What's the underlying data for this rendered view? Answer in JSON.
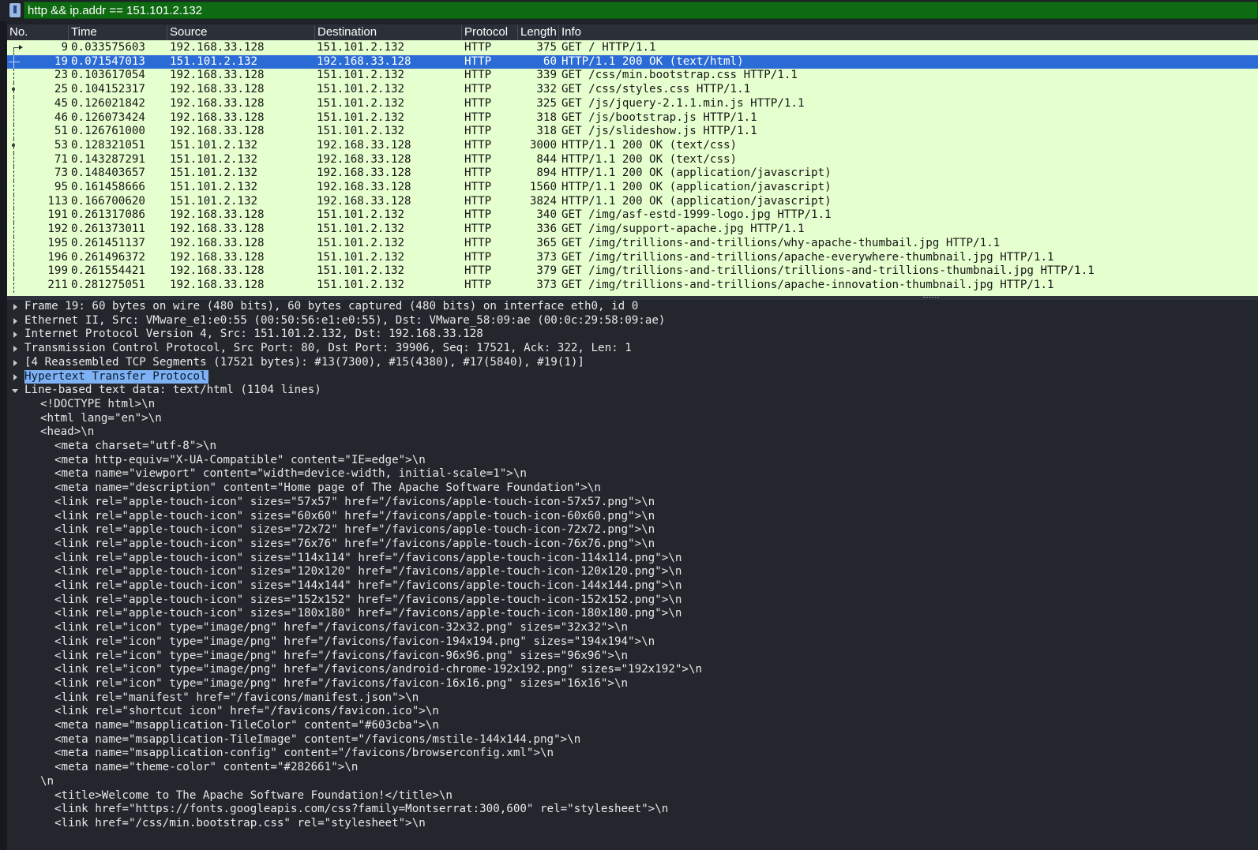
{
  "filter": {
    "value": "http && ip.addr == 151.101.2.132"
  },
  "columns": [
    "No.",
    "Time",
    "Source",
    "Destination",
    "Protocol",
    "Length",
    "Info"
  ],
  "packets": [
    {
      "no": "9",
      "time": "0.033575603",
      "src": "192.168.33.128",
      "dst": "151.101.2.132",
      "proto": "HTTP",
      "len": "375",
      "info": "GET / HTTP/1.1",
      "mark": "arrow"
    },
    {
      "no": "19",
      "time": "0.071547013",
      "src": "151.101.2.132",
      "dst": "192.168.33.128",
      "proto": "HTTP",
      "len": "60",
      "info": "HTTP/1.1 200 OK  (text/html)",
      "mark": "selected"
    },
    {
      "no": "23",
      "time": "0.103617054",
      "src": "192.168.33.128",
      "dst": "151.101.2.132",
      "proto": "HTTP",
      "len": "339",
      "info": "GET /css/min.bootstrap.css HTTP/1.1",
      "mark": "line"
    },
    {
      "no": "25",
      "time": "0.104152317",
      "src": "192.168.33.128",
      "dst": "151.101.2.132",
      "proto": "HTTP",
      "len": "332",
      "info": "GET /css/styles.css HTTP/1.1",
      "mark": "dot"
    },
    {
      "no": "45",
      "time": "0.126021842",
      "src": "192.168.33.128",
      "dst": "151.101.2.132",
      "proto": "HTTP",
      "len": "325",
      "info": "GET /js/jquery-2.1.1.min.js HTTP/1.1",
      "mark": "line"
    },
    {
      "no": "46",
      "time": "0.126073424",
      "src": "192.168.33.128",
      "dst": "151.101.2.132",
      "proto": "HTTP",
      "len": "318",
      "info": "GET /js/bootstrap.js HTTP/1.1",
      "mark": "line"
    },
    {
      "no": "51",
      "time": "0.126761000",
      "src": "192.168.33.128",
      "dst": "151.101.2.132",
      "proto": "HTTP",
      "len": "318",
      "info": "GET /js/slideshow.js HTTP/1.1",
      "mark": "line"
    },
    {
      "no": "53",
      "time": "0.128321051",
      "src": "151.101.2.132",
      "dst": "192.168.33.128",
      "proto": "HTTP",
      "len": "3000",
      "info": "HTTP/1.1 200 OK  (text/css)",
      "mark": "dot"
    },
    {
      "no": "71",
      "time": "0.143287291",
      "src": "151.101.2.132",
      "dst": "192.168.33.128",
      "proto": "HTTP",
      "len": "844",
      "info": "HTTP/1.1 200 OK  (text/css)",
      "mark": "line"
    },
    {
      "no": "73",
      "time": "0.148403657",
      "src": "151.101.2.132",
      "dst": "192.168.33.128",
      "proto": "HTTP",
      "len": "894",
      "info": "HTTP/1.1 200 OK  (application/javascript)",
      "mark": "line"
    },
    {
      "no": "95",
      "time": "0.161458666",
      "src": "151.101.2.132",
      "dst": "192.168.33.128",
      "proto": "HTTP",
      "len": "1560",
      "info": "HTTP/1.1 200 OK  (application/javascript)",
      "mark": "line"
    },
    {
      "no": "113",
      "time": "0.166700620",
      "src": "151.101.2.132",
      "dst": "192.168.33.128",
      "proto": "HTTP",
      "len": "3824",
      "info": "HTTP/1.1 200 OK  (application/javascript)",
      "mark": "line"
    },
    {
      "no": "191",
      "time": "0.261317086",
      "src": "192.168.33.128",
      "dst": "151.101.2.132",
      "proto": "HTTP",
      "len": "340",
      "info": "GET /img/asf-estd-1999-logo.jpg HTTP/1.1",
      "mark": "line"
    },
    {
      "no": "192",
      "time": "0.261373011",
      "src": "192.168.33.128",
      "dst": "151.101.2.132",
      "proto": "HTTP",
      "len": "336",
      "info": "GET /img/support-apache.jpg HTTP/1.1",
      "mark": "line"
    },
    {
      "no": "195",
      "time": "0.261451137",
      "src": "192.168.33.128",
      "dst": "151.101.2.132",
      "proto": "HTTP",
      "len": "365",
      "info": "GET /img/trillions-and-trillions/why-apache-thumbail.jpg HTTP/1.1",
      "mark": "line"
    },
    {
      "no": "196",
      "time": "0.261496372",
      "src": "192.168.33.128",
      "dst": "151.101.2.132",
      "proto": "HTTP",
      "len": "373",
      "info": "GET /img/trillions-and-trillions/apache-everywhere-thumbnail.jpg HTTP/1.1",
      "mark": "line"
    },
    {
      "no": "199",
      "time": "0.261554421",
      "src": "192.168.33.128",
      "dst": "151.101.2.132",
      "proto": "HTTP",
      "len": "379",
      "info": "GET /img/trillions-and-trillions/trillions-and-trillions-thumbnail.jpg HTTP/1.1",
      "mark": "line"
    },
    {
      "no": "211",
      "time": "0.281275051",
      "src": "192.168.33.128",
      "dst": "151.101.2.132",
      "proto": "HTTP",
      "len": "373",
      "info": "GET /img/trillions-and-trillions/apache-innovation-thumbnail.jpg HTTP/1.1",
      "mark": "line"
    }
  ],
  "details": [
    {
      "text": "Frame 19: 60 bytes on wire (480 bits), 60 bytes captured (480 bits) on interface eth0, id 0",
      "state": "collapsed",
      "level": 0
    },
    {
      "text": "Ethernet II, Src: VMware_e1:e0:55 (00:50:56:e1:e0:55), Dst: VMware_58:09:ae (00:0c:29:58:09:ae)",
      "state": "collapsed",
      "level": 0
    },
    {
      "text": "Internet Protocol Version 4, Src: 151.101.2.132, Dst: 192.168.33.128",
      "state": "collapsed",
      "level": 0
    },
    {
      "text": "Transmission Control Protocol, Src Port: 80, Dst Port: 39906, Seq: 17521, Ack: 322, Len: 1",
      "state": "collapsed",
      "level": 0
    },
    {
      "text": "[4 Reassembled TCP Segments (17521 bytes): #13(7300), #15(4380), #17(5840), #19(1)]",
      "state": "collapsed",
      "level": 0
    },
    {
      "text": "Hypertext Transfer Protocol",
      "state": "collapsed",
      "level": 0,
      "highlight": true
    },
    {
      "text": "Line-based text data: text/html (1104 lines)",
      "state": "expanded",
      "level": 0
    },
    {
      "text": "<!DOCTYPE html>\\n",
      "level": 1
    },
    {
      "text": "<html lang=\"en\">\\n",
      "level": 1
    },
    {
      "text": "<head>\\n",
      "level": 1
    },
    {
      "text": "<meta charset=\"utf-8\">\\n",
      "level": 2
    },
    {
      "text": "<meta http-equiv=\"X-UA-Compatible\" content=\"IE=edge\">\\n",
      "level": 2
    },
    {
      "text": "<meta name=\"viewport\" content=\"width=device-width, initial-scale=1\">\\n",
      "level": 2
    },
    {
      "text": "<meta name=\"description\" content=\"Home page of The Apache Software Foundation\">\\n",
      "level": 2
    },
    {
      "text": "<link rel=\"apple-touch-icon\" sizes=\"57x57\" href=\"/favicons/apple-touch-icon-57x57.png\">\\n",
      "level": 2
    },
    {
      "text": "<link rel=\"apple-touch-icon\" sizes=\"60x60\" href=\"/favicons/apple-touch-icon-60x60.png\">\\n",
      "level": 2
    },
    {
      "text": "<link rel=\"apple-touch-icon\" sizes=\"72x72\" href=\"/favicons/apple-touch-icon-72x72.png\">\\n",
      "level": 2
    },
    {
      "text": "<link rel=\"apple-touch-icon\" sizes=\"76x76\" href=\"/favicons/apple-touch-icon-76x76.png\">\\n",
      "level": 2
    },
    {
      "text": "<link rel=\"apple-touch-icon\" sizes=\"114x114\" href=\"/favicons/apple-touch-icon-114x114.png\">\\n",
      "level": 2
    },
    {
      "text": "<link rel=\"apple-touch-icon\" sizes=\"120x120\" href=\"/favicons/apple-touch-icon-120x120.png\">\\n",
      "level": 2
    },
    {
      "text": "<link rel=\"apple-touch-icon\" sizes=\"144x144\" href=\"/favicons/apple-touch-icon-144x144.png\">\\n",
      "level": 2
    },
    {
      "text": "<link rel=\"apple-touch-icon\" sizes=\"152x152\" href=\"/favicons/apple-touch-icon-152x152.png\">\\n",
      "level": 2
    },
    {
      "text": "<link rel=\"apple-touch-icon\" sizes=\"180x180\" href=\"/favicons/apple-touch-icon-180x180.png\">\\n",
      "level": 2
    },
    {
      "text": "<link rel=\"icon\" type=\"image/png\" href=\"/favicons/favicon-32x32.png\" sizes=\"32x32\">\\n",
      "level": 2
    },
    {
      "text": "<link rel=\"icon\" type=\"image/png\" href=\"/favicons/favicon-194x194.png\" sizes=\"194x194\">\\n",
      "level": 2
    },
    {
      "text": "<link rel=\"icon\" type=\"image/png\" href=\"/favicons/favicon-96x96.png\" sizes=\"96x96\">\\n",
      "level": 2
    },
    {
      "text": "<link rel=\"icon\" type=\"image/png\" href=\"/favicons/android-chrome-192x192.png\" sizes=\"192x192\">\\n",
      "level": 2
    },
    {
      "text": "<link rel=\"icon\" type=\"image/png\" href=\"/favicons/favicon-16x16.png\" sizes=\"16x16\">\\n",
      "level": 2
    },
    {
      "text": "<link rel=\"manifest\" href=\"/favicons/manifest.json\">\\n",
      "level": 2
    },
    {
      "text": "<link rel=\"shortcut icon\" href=\"/favicons/favicon.ico\">\\n",
      "level": 2
    },
    {
      "text": "<meta name=\"msapplication-TileColor\" content=\"#603cba\">\\n",
      "level": 2
    },
    {
      "text": "<meta name=\"msapplication-TileImage\" content=\"/favicons/mstile-144x144.png\">\\n",
      "level": 2
    },
    {
      "text": "<meta name=\"msapplication-config\" content=\"/favicons/browserconfig.xml\">\\n",
      "level": 2
    },
    {
      "text": "<meta name=\"theme-color\" content=\"#282661\">\\n",
      "level": 2
    },
    {
      "text": "\\n",
      "level": 1
    },
    {
      "text": "<title>Welcome to The Apache Software Foundation!</title>\\n",
      "level": 2
    },
    {
      "text": "<link href=\"https://fonts.googleapis.com/css?family=Montserrat:300,600\" rel=\"stylesheet\">\\n",
      "level": 2
    },
    {
      "text": "<link href=\"/css/min.bootstrap.css\" rel=\"stylesheet\">\\n",
      "level": 2
    }
  ],
  "icons": {
    "filter_bookmark": "bookmark-icon"
  },
  "colors": {
    "filter_bg": "#0f6b12",
    "row_bg": "#e6ffcf",
    "selected_bg": "#2a6bd6",
    "highlight_bg": "#7eb2f5",
    "details_bg": "#23262d"
  }
}
